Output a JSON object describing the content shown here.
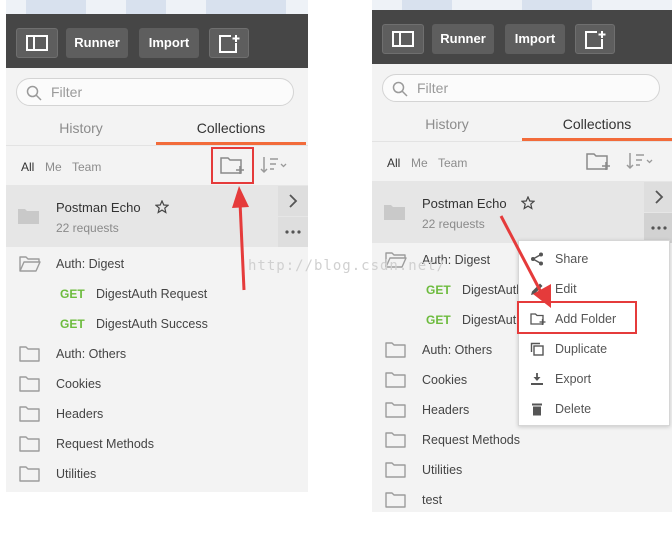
{
  "toolbar": {
    "runner_label": "Runner",
    "import_label": "Import"
  },
  "search": {
    "placeholder": "Filter"
  },
  "tabs": {
    "history": "History",
    "collections": "Collections"
  },
  "filters": {
    "all": "All",
    "me": "Me",
    "team": "Team"
  },
  "collection": {
    "name": "Postman Echo",
    "requests": "22 requests"
  },
  "left_tree": [
    {
      "kind": "folder",
      "label": "Auth: Digest",
      "open": true
    },
    {
      "kind": "request",
      "method": "GET",
      "label": "DigestAuth Request"
    },
    {
      "kind": "request",
      "method": "GET",
      "label": "DigestAuth Success"
    },
    {
      "kind": "folder",
      "label": "Auth: Others"
    },
    {
      "kind": "folder",
      "label": "Cookies"
    },
    {
      "kind": "folder",
      "label": "Headers"
    },
    {
      "kind": "folder",
      "label": "Request Methods"
    },
    {
      "kind": "folder",
      "label": "Utilities"
    }
  ],
  "right_tree": [
    {
      "kind": "folder",
      "label": "Auth: Digest",
      "open": true
    },
    {
      "kind": "request",
      "method": "GET",
      "label": "DigestAuth"
    },
    {
      "kind": "request",
      "method": "GET",
      "label": "DigestAuth"
    },
    {
      "kind": "folder",
      "label": "Auth: Others"
    },
    {
      "kind": "folder",
      "label": "Cookies"
    },
    {
      "kind": "folder",
      "label": "Headers"
    },
    {
      "kind": "folder",
      "label": "Request Methods"
    },
    {
      "kind": "folder",
      "label": "Utilities"
    },
    {
      "kind": "folder",
      "label": "test"
    }
  ],
  "context_menu": [
    {
      "label": "Share",
      "icon": "share-icon"
    },
    {
      "label": "Edit",
      "icon": "pencil-icon"
    },
    {
      "label": "Add Folder",
      "icon": "add-folder-icon"
    },
    {
      "label": "Duplicate",
      "icon": "duplicate-icon"
    },
    {
      "label": "Export",
      "icon": "export-icon"
    },
    {
      "label": "Delete",
      "icon": "trash-icon"
    }
  ],
  "watermark": "http://blog.csdn.net/",
  "colors": {
    "accent": "#f26b3a",
    "get": "#6dbb3e",
    "annotation": "#e53b3b",
    "header": "#464646"
  }
}
